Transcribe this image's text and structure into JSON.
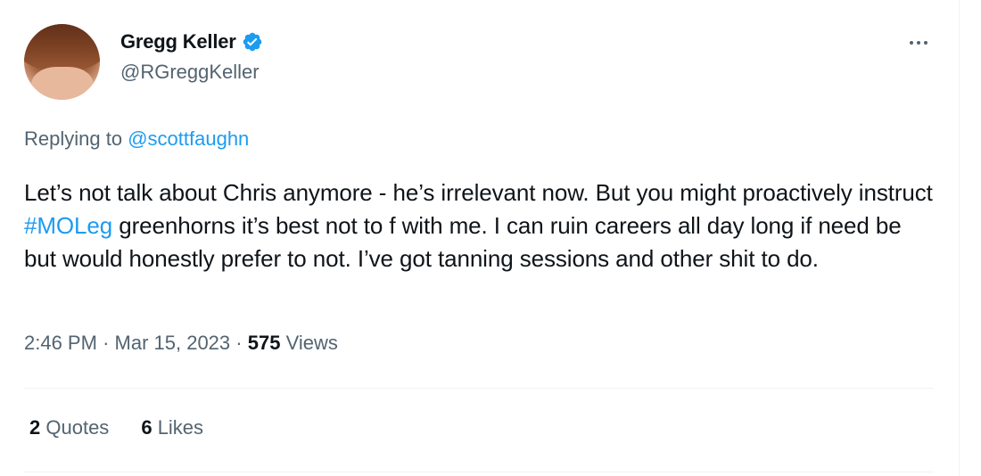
{
  "author": {
    "display_name": "Gregg Keller",
    "handle": "@RGreggKeller",
    "verified": true,
    "avatar": "avatar-photo"
  },
  "icons": {
    "verified": "verified-badge-icon",
    "more": "more-options-icon"
  },
  "reply": {
    "prefix": "Replying to",
    "mention": "@scottfaughn"
  },
  "tweet": {
    "text_before_hashtag": "Let’s not talk about Chris anymore - he’s irrelevant now. But you might proactively instruct",
    "hashtag": "#MOLeg",
    "text_after_hashtag": "greenhorns it’s best not to f with me. I can ruin careers all day long if need be but would honestly prefer to not. I’ve got tanning sessions and other shit to do."
  },
  "meta": {
    "time": "2:46 PM",
    "separator1": "·",
    "date": "Mar 15, 2023",
    "separator2": "·",
    "views_count": "575",
    "views_label": "Views"
  },
  "stats": {
    "quotes_count": "2",
    "quotes_label": "Quotes",
    "likes_count": "6",
    "likes_label": "Likes"
  },
  "colors": {
    "text": "#0f1419",
    "secondary": "#536471",
    "link": "#1d9bf0",
    "divider": "#eff3f4"
  }
}
